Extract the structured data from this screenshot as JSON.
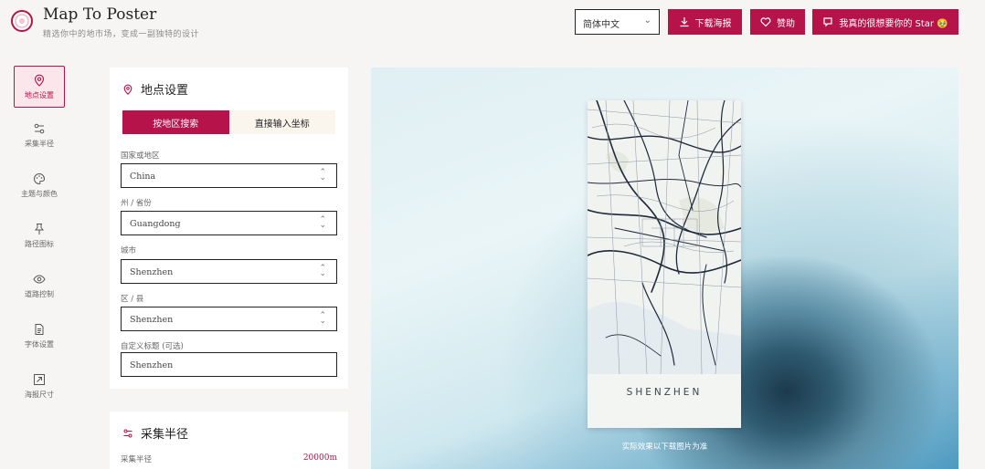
{
  "header": {
    "title": "Map To Poster",
    "subtitle": "精选你中的地市场，变成一副独特的设计",
    "language": "简体中文",
    "download_label": "下载海报",
    "sponsor_label": "赞助",
    "star_label": "我真的很想要你的 Star 🥹",
    "accent_color": "#b5134a"
  },
  "nav": {
    "items": [
      {
        "label": "地点设置",
        "icon": "map-pin-icon",
        "active": true
      },
      {
        "label": "采集半径",
        "icon": "sliders-icon",
        "active": false
      },
      {
        "label": "主题与颜色",
        "icon": "palette-icon",
        "active": false
      },
      {
        "label": "路径图标",
        "icon": "pin-icon",
        "active": false
      },
      {
        "label": "道路控制",
        "icon": "eye-icon",
        "active": false
      },
      {
        "label": "字体设置",
        "icon": "document-icon",
        "active": false
      },
      {
        "label": "海报尺寸",
        "icon": "resize-icon",
        "active": false
      }
    ]
  },
  "location_panel": {
    "title": "地点设置",
    "tabs": [
      "按地区搜索",
      "直接输入坐标"
    ],
    "fields": [
      {
        "label": "国家或地区",
        "value": "China"
      },
      {
        "label": "州 / 省份",
        "value": "Guangdong"
      },
      {
        "label": "城市",
        "value": "Shenzhen"
      },
      {
        "label": "区 / 县",
        "value": "Shenzhen"
      },
      {
        "label": "自定义标题 (可选)",
        "value": "Shenzhen"
      }
    ]
  },
  "radius_panel": {
    "title": "采集半径",
    "label": "采集半径",
    "value": "20000m"
  },
  "preview": {
    "city_name": "SHENZHEN",
    "note": "实际效果以下载图片为准"
  }
}
